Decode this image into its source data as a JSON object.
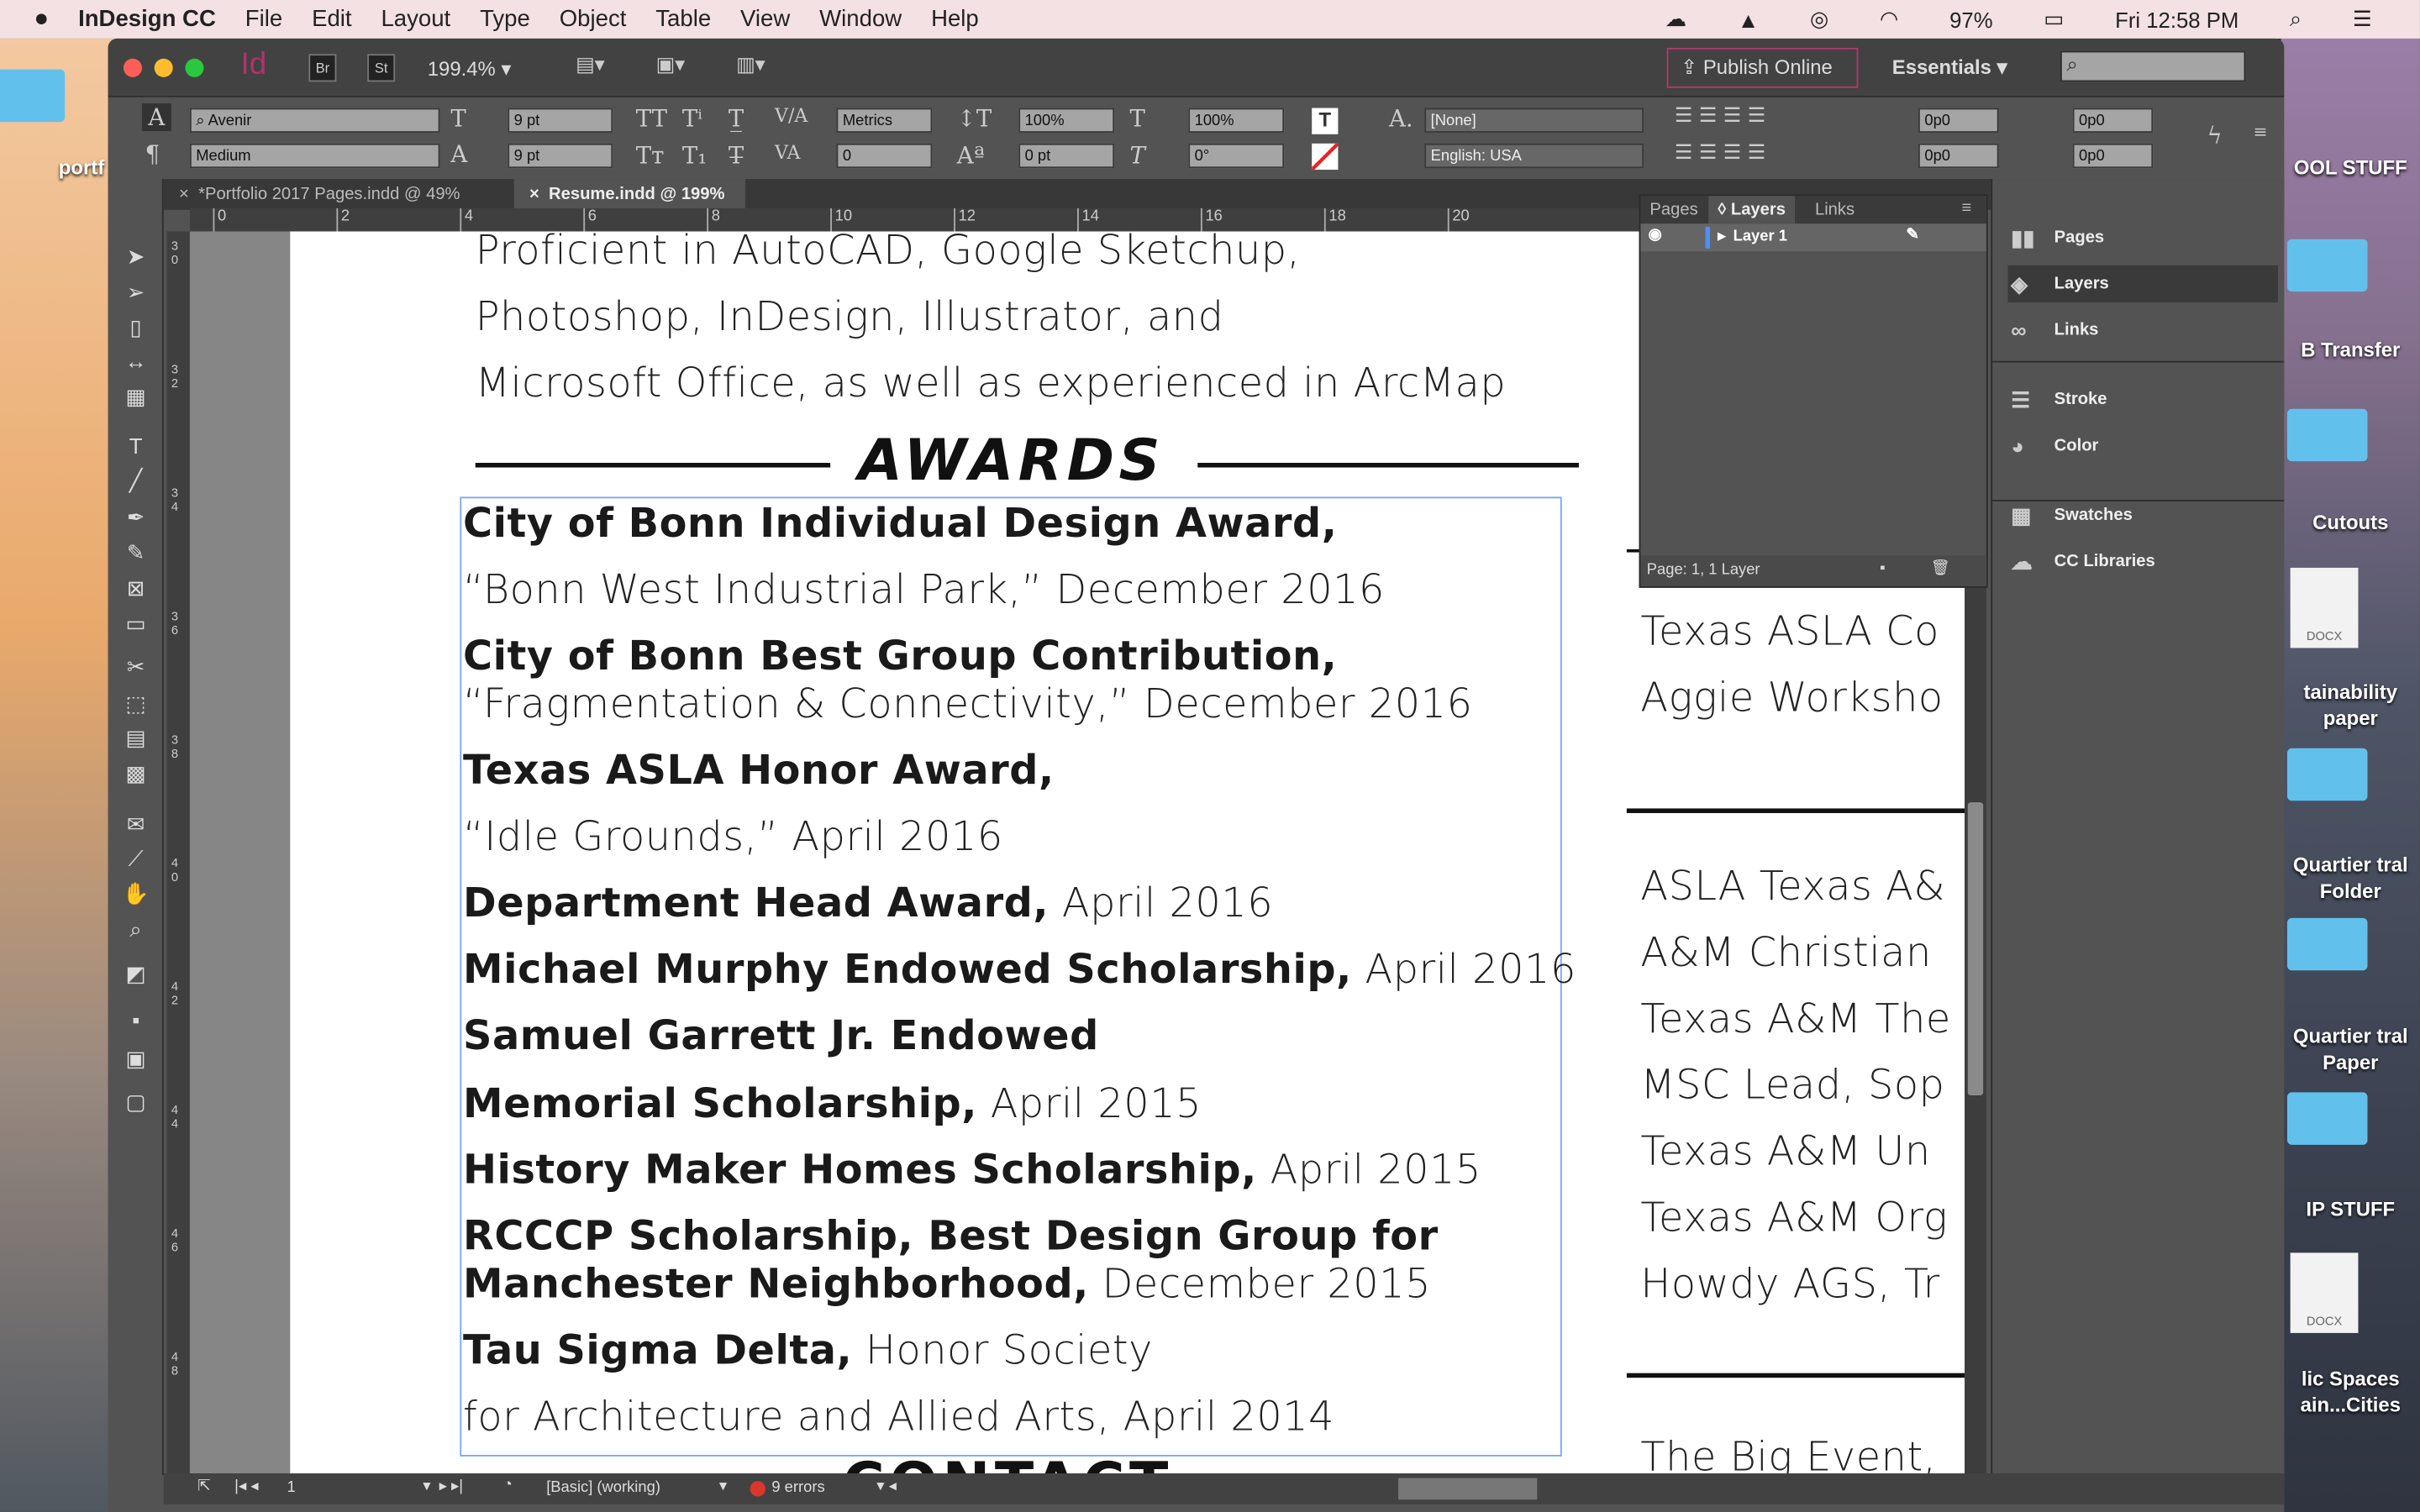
{
  "menubar": {
    "app": "InDesign CC",
    "items": [
      "File",
      "Edit",
      "Layout",
      "Type",
      "Object",
      "Table",
      "View",
      "Window",
      "Help"
    ],
    "battery": "97%",
    "clock": "Fri 12:58 PM"
  },
  "desktop": {
    "left_label": "portf",
    "right_items": [
      "OOL STUFF",
      "B Transfer",
      "Cutouts",
      "tainability paper",
      "Quartier tral Folder",
      "Quartier tral Paper",
      "IP STUFF",
      "lic Spaces ain...Cities"
    ],
    "docx": "DOCX"
  },
  "appbar": {
    "logo": "Id",
    "bridge": "Br",
    "stock": "St",
    "zoom": "199.4%",
    "publish": "Publish Online",
    "workspace": "Essentials",
    "search_placeholder": ""
  },
  "control": {
    "font": "Avenir",
    "style": "Medium",
    "size": "9 pt",
    "leading": "9 pt",
    "kerning": "Metrics",
    "tracking": "0",
    "vscale": "100%",
    "hscale": "100%",
    "baseline": "0 pt",
    "skew": "0°",
    "char_style": "[None]",
    "language": "English: USA",
    "indent_left": "0p0",
    "indent_right": "0p0",
    "indent_first": "0p0",
    "indent_last": "0p0"
  },
  "tabs": [
    {
      "label": "*Portfolio 2017 Pages.indd @ 49%",
      "active": false
    },
    {
      "label": "Resume.indd @ 199%",
      "active": true
    }
  ],
  "ruler": [
    "0",
    "2",
    "4",
    "6",
    "8",
    "10",
    "12",
    "14",
    "16",
    "18",
    "20"
  ],
  "vruler": [
    "3 0",
    "3 2",
    "3 4",
    "3 6",
    "3 8",
    "4 0",
    "4 2",
    "4 4",
    "4 6",
    "4 8"
  ],
  "page": {
    "intro": [
      "Proficient in AutoCAD, Google Sketchup,",
      "Photoshop, InDesign, Illustrator, and",
      "Microsoft Office, as well as experienced in ArcMap"
    ],
    "heading": "AWARDS",
    "awards": [
      {
        "b": "City of Bonn Individual Design Award,",
        "r": ""
      },
      {
        "b": "",
        "r": "“Bonn West Industrial Park,” December 2016"
      },
      {
        "b": "City of Bonn Best Group Contribution,",
        "r": ""
      },
      {
        "b": "",
        "r": "“Fragmentation & Connectivity,” December 2016"
      },
      {
        "b": "Texas ASLA Honor Award,",
        "r": ""
      },
      {
        "b": "",
        "r": "“Idle Grounds,” April 2016"
      },
      {
        "b": "Department Head Award,",
        "r": " April 2016"
      },
      {
        "b": "Michael Murphy Endowed Scholarship,",
        "r": " April 2016"
      },
      {
        "b": "Samuel Garrett Jr. Endowed",
        "r": ""
      },
      {
        "b": "Memorial Scholarship,",
        "r": " April 2015"
      },
      {
        "b": "History Maker Homes Scholarship,",
        "r": " April 2015"
      },
      {
        "b": "RCCCP Scholarship, Best Design Group for",
        "r": ""
      },
      {
        "b": "Manchester Neighborhood,",
        "r": " December 2015"
      },
      {
        "b": "Tau Sigma Delta,",
        "r": " Honor Society"
      },
      {
        "b": "",
        "r": "for Architecture and Allied Arts, April 2014"
      }
    ],
    "next_heading": "CONTACT",
    "right_col": [
      "Texas ASLA Co",
      "Aggie Worksho",
      "ASLA Texas A&",
      "A&M Christian",
      "Texas A&M The",
      "MSC Lead, Sop",
      "Texas A&M Un",
      "Texas A&M Org",
      "Howdy AGS, Tr",
      "The Big Event,"
    ]
  },
  "layers_panel": {
    "tabs": [
      "Pages",
      "Layers",
      "Links"
    ],
    "active": "Layers",
    "layer": "Layer 1",
    "footer": "Page: 1, 1 Layer",
    "layer_color": "#4f8ff7"
  },
  "dock": [
    {
      "label": "Pages",
      "icon": "pages-icon"
    },
    {
      "label": "Layers",
      "icon": "layers-icon"
    },
    {
      "label": "Links",
      "icon": "links-icon"
    },
    {
      "label": "Stroke",
      "icon": "stroke-icon"
    },
    {
      "label": "Color",
      "icon": "color-icon"
    },
    {
      "label": "Swatches",
      "icon": "swatches-icon"
    },
    {
      "label": "CC Libraries",
      "icon": "cc-libraries-icon"
    }
  ],
  "status": {
    "page": "1",
    "preflight_profile": "[Basic] (working)",
    "errors": "9 errors"
  },
  "colors": {
    "publish_border": "#b03a6a",
    "id_logo": "#b0336b",
    "error": "#d9372e",
    "selection": "#4f8ff7"
  }
}
